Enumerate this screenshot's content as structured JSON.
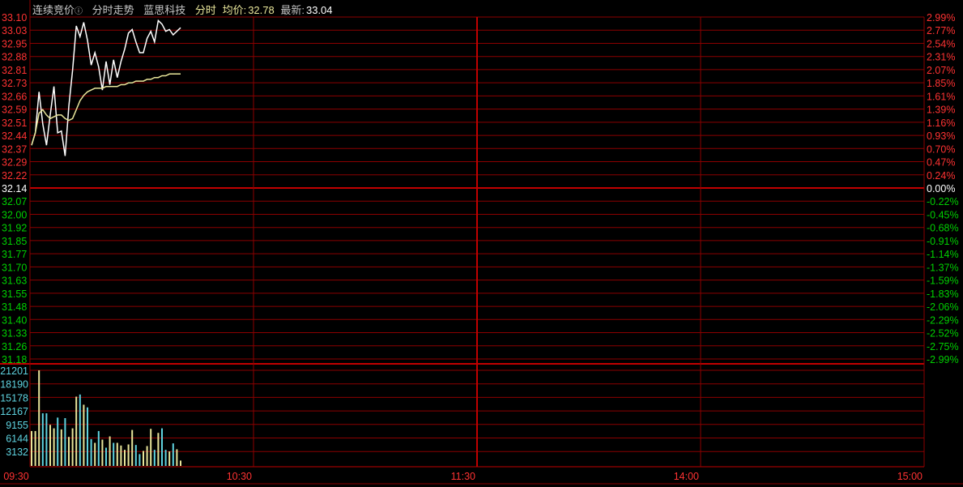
{
  "header": {
    "mode": "连续竞价",
    "info_icon": "info-circle-icon",
    "view": "分时走势",
    "stock_name": "蓝思科技",
    "period": "分时",
    "avg_label": "均价:",
    "avg_value": "32.78",
    "last_label": "最新:",
    "last_value": "33.04"
  },
  "colors": {
    "up": "#ff3232",
    "down": "#00d000",
    "grid": "#8b0000",
    "price_line": "#ffffff",
    "avg_line": "#e8e59a",
    "vol_up": "#e8e59a",
    "vol_down": "#5fd3e0",
    "vol_axis": "#5fd3e0"
  },
  "chart_data": [
    {
      "type": "line",
      "title": "分时走势",
      "prev_close": 32.14,
      "ylim": [
        31.18,
        33.1
      ],
      "y_ticks_left": [
        "33.10",
        "33.03",
        "32.95",
        "32.88",
        "32.81",
        "32.73",
        "32.66",
        "32.59",
        "32.51",
        "32.44",
        "32.37",
        "32.29",
        "32.22",
        "32.14",
        "32.07",
        "32.00",
        "31.92",
        "31.85",
        "31.77",
        "31.70",
        "31.63",
        "31.55",
        "31.48",
        "31.40",
        "31.33",
        "31.26",
        "31.18"
      ],
      "y_ticks_right": [
        "2.99%",
        "2.77%",
        "2.54%",
        "2.31%",
        "2.07%",
        "1.85%",
        "1.61%",
        "1.39%",
        "1.16%",
        "0.93%",
        "0.70%",
        "0.47%",
        "0.24%",
        "0.00%",
        "-0.22%",
        "-0.45%",
        "-0.68%",
        "-0.91%",
        "-1.14%",
        "-1.37%",
        "-1.59%",
        "-1.83%",
        "-2.06%",
        "-2.29%",
        "-2.52%",
        "-2.75%",
        "-2.99%"
      ],
      "x_minutes_total": 240,
      "series": [
        {
          "name": "price",
          "values": [
            32.38,
            32.45,
            32.68,
            32.5,
            32.38,
            32.55,
            32.71,
            32.45,
            32.46,
            32.32,
            32.6,
            32.8,
            33.05,
            32.99,
            33.07,
            32.97,
            32.83,
            32.9,
            32.82,
            32.69,
            32.85,
            32.72,
            32.86,
            32.76,
            32.85,
            32.92,
            33.01,
            33.03,
            32.96,
            32.9,
            32.9,
            32.98,
            33.02,
            32.96,
            33.08,
            33.06,
            33.02,
            33.03,
            33.0,
            33.02,
            33.04
          ]
        },
        {
          "name": "avg",
          "values": [
            32.38,
            32.45,
            32.56,
            32.58,
            32.55,
            32.53,
            32.54,
            32.55,
            32.55,
            32.53,
            32.52,
            32.53,
            32.58,
            32.63,
            32.66,
            32.68,
            32.69,
            32.7,
            32.7,
            32.7,
            32.71,
            32.71,
            32.71,
            32.71,
            32.72,
            32.72,
            32.73,
            32.73,
            32.74,
            32.74,
            32.74,
            32.75,
            32.75,
            32.76,
            32.76,
            32.77,
            32.77,
            32.78,
            32.78,
            32.78,
            32.78
          ]
        }
      ]
    },
    {
      "type": "bar",
      "title": "成交量",
      "ylim": [
        0,
        21201
      ],
      "y_ticks": [
        "21201",
        "18190",
        "15178",
        "12167",
        "9155",
        "6144",
        "3132"
      ],
      "values": [
        7742,
        7742,
        21201,
        11672,
        11672,
        9111,
        8337,
        10719,
        8099,
        10600,
        6431,
        8337,
        15364,
        15840,
        13577,
        12982,
        5955,
        5121,
        7742,
        5836,
        4049,
        6550,
        5121,
        5121,
        4526,
        3573,
        4764,
        7980,
        4645,
        2620,
        3335,
        4407,
        8218,
        3573,
        7325,
        8337,
        3573,
        3216,
        5002,
        3692,
        1191
      ],
      "directions": [
        "u",
        "u",
        "u",
        "d",
        "d",
        "u",
        "u",
        "d",
        "u",
        "d",
        "u",
        "u",
        "u",
        "d",
        "u",
        "d",
        "d",
        "u",
        "d",
        "u",
        "d",
        "u",
        "d",
        "u",
        "u",
        "u",
        "u",
        "u",
        "d",
        "d",
        "u",
        "u",
        "u",
        "d",
        "u",
        "d",
        "d",
        "u",
        "d",
        "u",
        "u"
      ]
    }
  ],
  "x_ticks": [
    "09:30",
    "10:30",
    "11:30",
    "14:00",
    "15:00"
  ]
}
